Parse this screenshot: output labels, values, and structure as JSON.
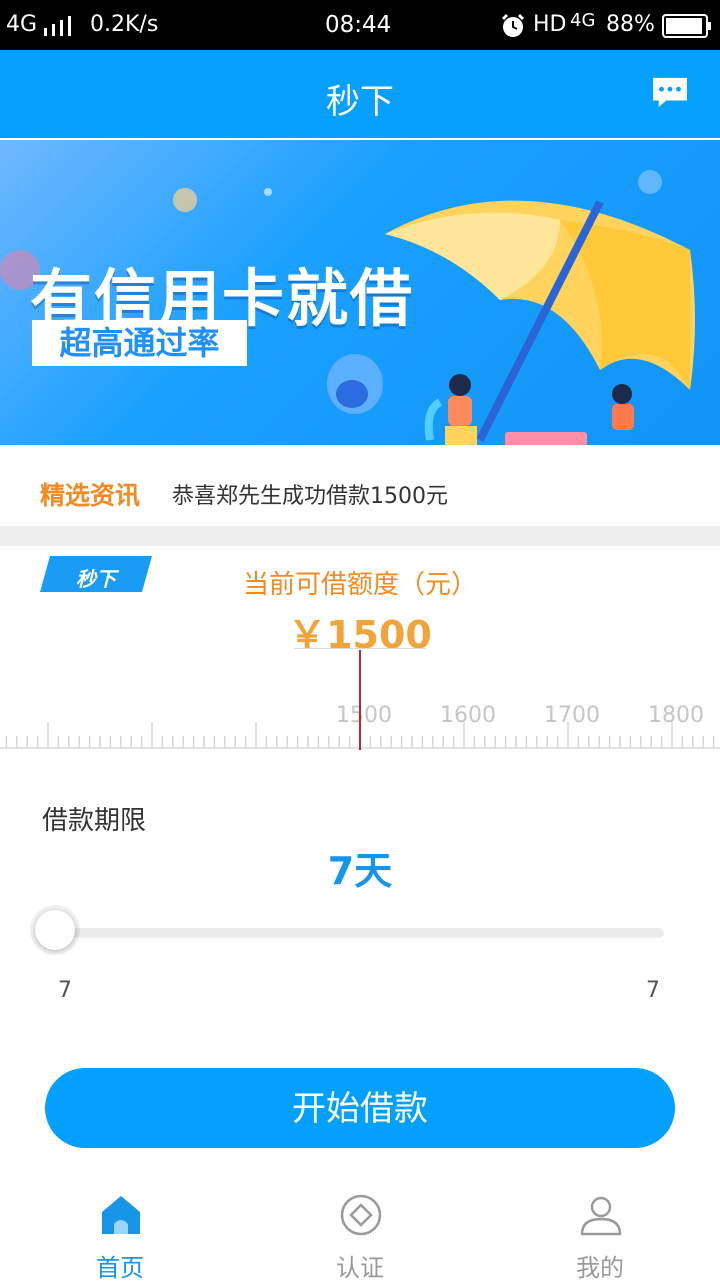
{
  "status_bar": {
    "network": "4G",
    "speed": "0.2K/s",
    "time": "08:44",
    "hd": "HD",
    "network2": "4G",
    "battery": "88%"
  },
  "header": {
    "title": "秒下",
    "message_icon": "chat-bubble-icon"
  },
  "banner": {
    "headline": "有信用卡就借",
    "sub": "超高通过率"
  },
  "news": {
    "tag": "精选资讯",
    "text": "恭喜郑先生成功借款1500元"
  },
  "amount": {
    "badge": "秒下",
    "label": "当前可借额度（元）",
    "value": "￥1500",
    "ruler_labels": [
      "1500",
      "1600",
      "1700",
      "1800"
    ]
  },
  "term": {
    "label": "借款期限",
    "value": "7天",
    "min": "7",
    "max": "7"
  },
  "cta": {
    "label": "开始借款"
  },
  "tabs": [
    {
      "label": "首页",
      "icon": "home-icon",
      "active": true
    },
    {
      "label": "认证",
      "icon": "verify-icon",
      "active": false
    },
    {
      "label": "我的",
      "icon": "profile-icon",
      "active": false
    }
  ],
  "colors": {
    "primary": "#07a0ff",
    "accent_orange": "#f58a1f",
    "tab_active": "#1795e8",
    "tab_inactive": "#9a9a9a"
  }
}
